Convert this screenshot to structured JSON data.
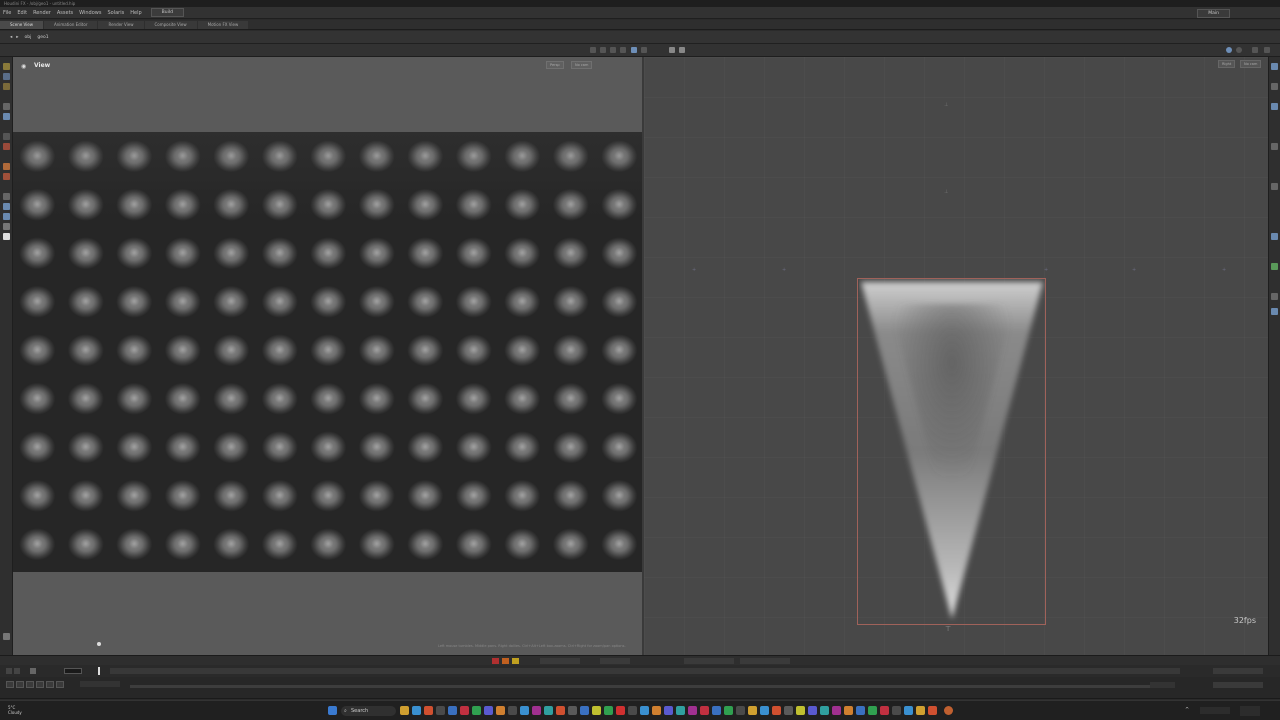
{
  "titlebar": {
    "text": "Houdini FX - /obj/geo1 - untitled.hip"
  },
  "menubar": {
    "items": [
      "File",
      "Edit",
      "Render",
      "Assets",
      "Windows",
      "Solaris",
      "Help"
    ],
    "desktop": "Build",
    "main": "Main"
  },
  "tabs": [
    "Scene View",
    "Animation Editor",
    "Render View",
    "Composite View",
    "Motion FX View"
  ],
  "path": {
    "obj": "obj",
    "geo": "geo1"
  },
  "viewport": {
    "label": "View",
    "chip_persp": "Persp",
    "chip_cam": "No cam"
  },
  "network": {
    "chip_left": "Right",
    "chip_right": "No cam",
    "fps": "32fps"
  },
  "statusline": {
    "text": "Left mouse tumbles. Middle pans. Right dollies. Ctrl+Alt+Left box-zooms. Ctrl+Right for zoom/pan options."
  },
  "taskbar": {
    "search_label": "Search",
    "weather_line1": "5°C",
    "weather_line2": "Cloudy"
  }
}
